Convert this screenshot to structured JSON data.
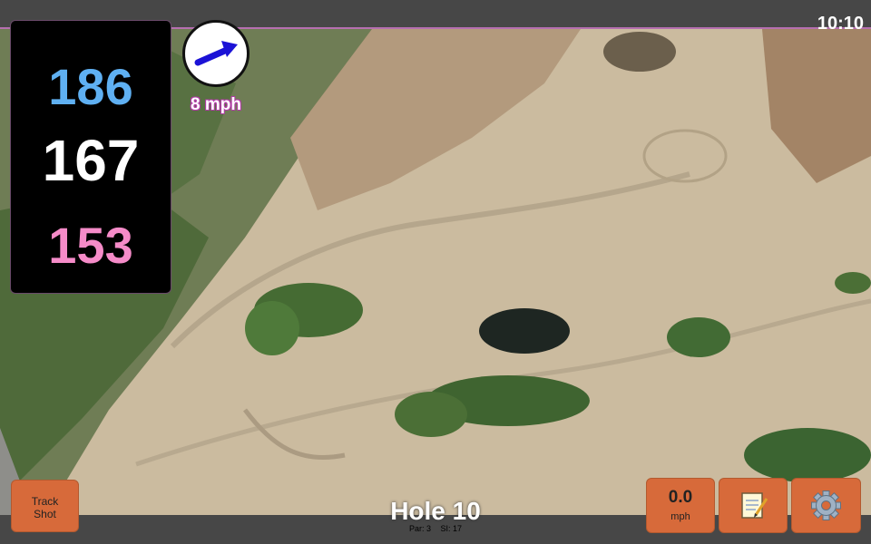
{
  "status": {
    "time": "10:10"
  },
  "distances": {
    "back": "186",
    "middle": "167",
    "front": "153"
  },
  "wind": {
    "speed_label": "8 mph",
    "icon": "wind-direction-arrow-icon",
    "arrow_color": "#1b12d6"
  },
  "buttons": {
    "track_shot_line1": "Track",
    "track_shot_line2": "Shot",
    "speed_value": "0.0",
    "speed_unit": "mph",
    "notes_icon": "notepad-icon",
    "settings_icon": "gear-icon"
  },
  "hole": {
    "title": "Hole 10",
    "par": "Par: 3",
    "si": "SI: 17"
  },
  "colors": {
    "back": "#5fb0f2",
    "middle": "#ffffff",
    "front": "#f58bc8",
    "button": "#d76a3a"
  }
}
